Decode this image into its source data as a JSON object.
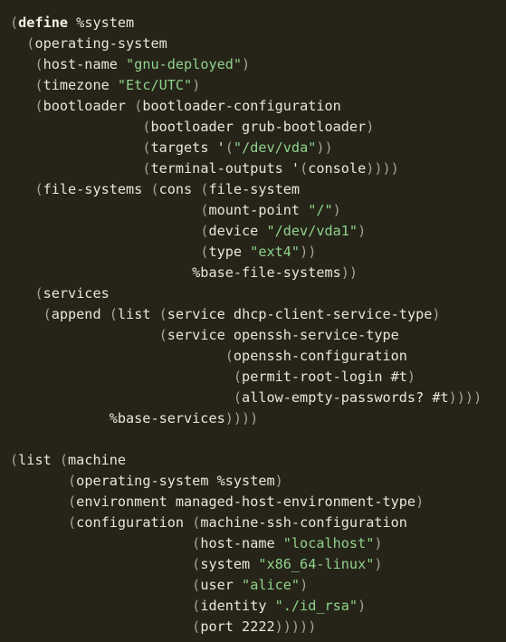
{
  "colors": {
    "background": "#262418",
    "text": "#e8e6d6",
    "keyword": "#f0efe0",
    "string": "#8fd28c",
    "paren": "#a6a394"
  },
  "code_lines": [
    [
      [
        "p",
        "("
      ],
      [
        "kw",
        "define"
      ],
      [
        "t",
        " %system"
      ]
    ],
    [
      [
        "t",
        "  "
      ],
      [
        "p",
        "("
      ],
      [
        "t",
        "operating-system"
      ]
    ],
    [
      [
        "t",
        "   "
      ],
      [
        "p",
        "("
      ],
      [
        "t",
        "host-name "
      ],
      [
        "str",
        "\"gnu-deployed\""
      ],
      [
        "p",
        ")"
      ]
    ],
    [
      [
        "t",
        "   "
      ],
      [
        "p",
        "("
      ],
      [
        "t",
        "timezone "
      ],
      [
        "str",
        "\"Etc/UTC\""
      ],
      [
        "p",
        ")"
      ]
    ],
    [
      [
        "t",
        "   "
      ],
      [
        "p",
        "("
      ],
      [
        "t",
        "bootloader "
      ],
      [
        "p",
        "("
      ],
      [
        "t",
        "bootloader-configuration"
      ]
    ],
    [
      [
        "t",
        "                "
      ],
      [
        "p",
        "("
      ],
      [
        "t",
        "bootloader grub-bootloader"
      ],
      [
        "p",
        ")"
      ]
    ],
    [
      [
        "t",
        "                "
      ],
      [
        "p",
        "("
      ],
      [
        "t",
        "targets '"
      ],
      [
        "p",
        "("
      ],
      [
        "str",
        "\"/dev/vda\""
      ],
      [
        "p",
        "))"
      ]
    ],
    [
      [
        "t",
        "                "
      ],
      [
        "p",
        "("
      ],
      [
        "t",
        "terminal-outputs '"
      ],
      [
        "p",
        "("
      ],
      [
        "t",
        "console"
      ],
      [
        "p",
        "))))"
      ]
    ],
    [
      [
        "t",
        "   "
      ],
      [
        "p",
        "("
      ],
      [
        "t",
        "file-systems "
      ],
      [
        "p",
        "("
      ],
      [
        "t",
        "cons "
      ],
      [
        "p",
        "("
      ],
      [
        "t",
        "file-system"
      ]
    ],
    [
      [
        "t",
        "                       "
      ],
      [
        "p",
        "("
      ],
      [
        "t",
        "mount-point "
      ],
      [
        "str",
        "\"/\""
      ],
      [
        "p",
        ")"
      ]
    ],
    [
      [
        "t",
        "                       "
      ],
      [
        "p",
        "("
      ],
      [
        "t",
        "device "
      ],
      [
        "str",
        "\"/dev/vda1\""
      ],
      [
        "p",
        ")"
      ]
    ],
    [
      [
        "t",
        "                       "
      ],
      [
        "p",
        "("
      ],
      [
        "t",
        "type "
      ],
      [
        "str",
        "\"ext4\""
      ],
      [
        "p",
        "))"
      ]
    ],
    [
      [
        "t",
        "                      %base-file-systems"
      ],
      [
        "p",
        "))"
      ]
    ],
    [
      [
        "t",
        "   "
      ],
      [
        "p",
        "("
      ],
      [
        "t",
        "services"
      ]
    ],
    [
      [
        "t",
        "    "
      ],
      [
        "p",
        "("
      ],
      [
        "t",
        "append "
      ],
      [
        "p",
        "("
      ],
      [
        "t",
        "list "
      ],
      [
        "p",
        "("
      ],
      [
        "t",
        "service dhcp-client-service-type"
      ],
      [
        "p",
        ")"
      ]
    ],
    [
      [
        "t",
        "                  "
      ],
      [
        "p",
        "("
      ],
      [
        "t",
        "service openssh-service-type"
      ]
    ],
    [
      [
        "t",
        "                          "
      ],
      [
        "p",
        "("
      ],
      [
        "t",
        "openssh-configuration"
      ]
    ],
    [
      [
        "t",
        "                           "
      ],
      [
        "p",
        "("
      ],
      [
        "t",
        "permit-root-login #t"
      ],
      [
        "p",
        ")"
      ]
    ],
    [
      [
        "t",
        "                           "
      ],
      [
        "p",
        "("
      ],
      [
        "t",
        "allow-empty-passwords? #t"
      ],
      [
        "p",
        "))))"
      ]
    ],
    [
      [
        "t",
        "            %base-services"
      ],
      [
        "p",
        "))))"
      ]
    ],
    [],
    [
      [
        "p",
        "("
      ],
      [
        "t",
        "list "
      ],
      [
        "p",
        "("
      ],
      [
        "t",
        "machine"
      ]
    ],
    [
      [
        "t",
        "       "
      ],
      [
        "p",
        "("
      ],
      [
        "t",
        "operating-system %system"
      ],
      [
        "p",
        ")"
      ]
    ],
    [
      [
        "t",
        "       "
      ],
      [
        "p",
        "("
      ],
      [
        "t",
        "environment managed-host-environment-type"
      ],
      [
        "p",
        ")"
      ]
    ],
    [
      [
        "t",
        "       "
      ],
      [
        "p",
        "("
      ],
      [
        "t",
        "configuration "
      ],
      [
        "p",
        "("
      ],
      [
        "t",
        "machine-ssh-configuration"
      ]
    ],
    [
      [
        "t",
        "                      "
      ],
      [
        "p",
        "("
      ],
      [
        "t",
        "host-name "
      ],
      [
        "str",
        "\"localhost\""
      ],
      [
        "p",
        ")"
      ]
    ],
    [
      [
        "t",
        "                      "
      ],
      [
        "p",
        "("
      ],
      [
        "t",
        "system "
      ],
      [
        "str",
        "\"x86_64-linux\""
      ],
      [
        "p",
        ")"
      ]
    ],
    [
      [
        "t",
        "                      "
      ],
      [
        "p",
        "("
      ],
      [
        "t",
        "user "
      ],
      [
        "str",
        "\"alice\""
      ],
      [
        "p",
        ")"
      ]
    ],
    [
      [
        "t",
        "                      "
      ],
      [
        "p",
        "("
      ],
      [
        "t",
        "identity "
      ],
      [
        "str",
        "\"./id_rsa\""
      ],
      [
        "p",
        ")"
      ]
    ],
    [
      [
        "t",
        "                      "
      ],
      [
        "p",
        "("
      ],
      [
        "t",
        "port 2222"
      ],
      [
        "p",
        ")))))"
      ]
    ]
  ]
}
